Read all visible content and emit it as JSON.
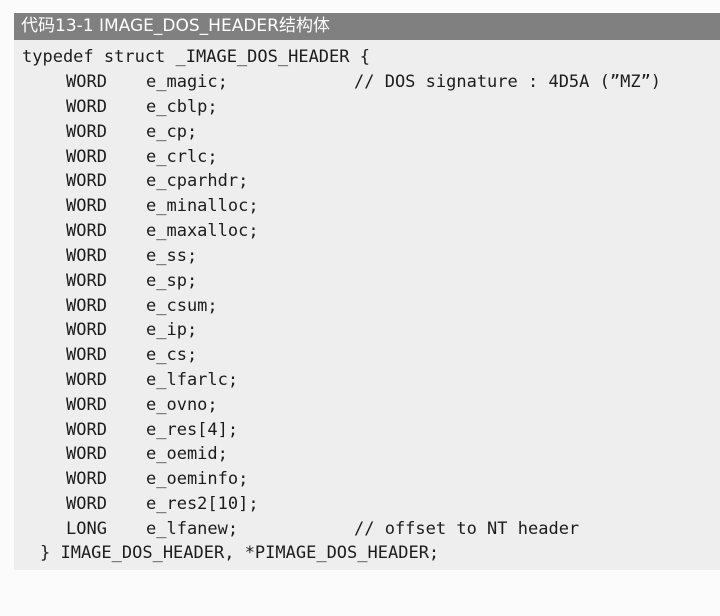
{
  "caption": "代码13-1   IMAGE_DOS_HEADER结构体",
  "code": {
    "open_line": "typedef struct _IMAGE_DOS_HEADER {",
    "fields": [
      {
        "type": "WORD",
        "name": "e_magic;",
        "comment": "// DOS signature : 4D5A (”MZ”)"
      },
      {
        "type": "WORD",
        "name": "e_cblp;"
      },
      {
        "type": "WORD",
        "name": "e_cp;"
      },
      {
        "type": "WORD",
        "name": "e_crlc;"
      },
      {
        "type": "WORD",
        "name": "e_cparhdr;"
      },
      {
        "type": "WORD",
        "name": "e_minalloc;"
      },
      {
        "type": "WORD",
        "name": "e_maxalloc;"
      },
      {
        "type": "WORD",
        "name": "e_ss;"
      },
      {
        "type": "WORD",
        "name": "e_sp;"
      },
      {
        "type": "WORD",
        "name": "e_csum;"
      },
      {
        "type": "WORD",
        "name": "e_ip;"
      },
      {
        "type": "WORD",
        "name": "e_cs;"
      },
      {
        "type": "WORD",
        "name": "e_lfarlc;"
      },
      {
        "type": "WORD",
        "name": "e_ovno;"
      },
      {
        "type": "WORD",
        "name": "e_res[4];"
      },
      {
        "type": "WORD",
        "name": "e_oemid;"
      },
      {
        "type": "WORD",
        "name": "e_oeminfo;"
      },
      {
        "type": "WORD",
        "name": "e_res2[10];"
      },
      {
        "type": "LONG",
        "name": "e_lfanew;",
        "comment": "// offset to NT header"
      }
    ],
    "close_line": "} IMAGE_DOS_HEADER, *PIMAGE_DOS_HEADER;"
  }
}
